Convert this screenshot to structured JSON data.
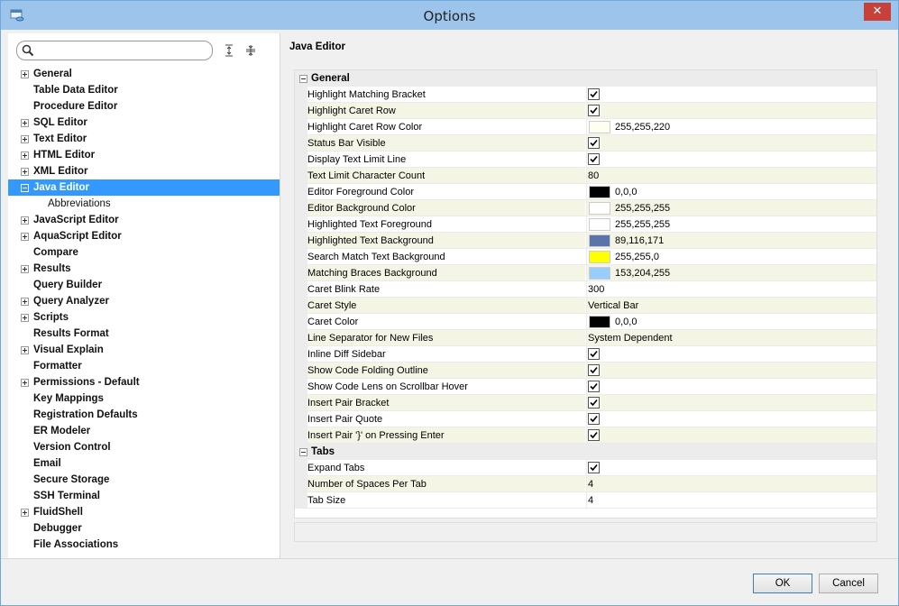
{
  "window": {
    "title": "Options",
    "close_glyph": "✕"
  },
  "search": {
    "placeholder": "",
    "value": ""
  },
  "tree": [
    {
      "label": "General",
      "expander": "plus"
    },
    {
      "label": "Table Data Editor",
      "expander": "none"
    },
    {
      "label": "Procedure Editor",
      "expander": "none"
    },
    {
      "label": "SQL Editor",
      "expander": "plus"
    },
    {
      "label": "Text Editor",
      "expander": "plus"
    },
    {
      "label": "HTML Editor",
      "expander": "plus"
    },
    {
      "label": "XML Editor",
      "expander": "plus"
    },
    {
      "label": "Java Editor",
      "expander": "minus",
      "selected": true
    },
    {
      "label": "Abbreviations",
      "expander": "none",
      "sub": true
    },
    {
      "label": "JavaScript Editor",
      "expander": "plus"
    },
    {
      "label": "AquaScript Editor",
      "expander": "plus"
    },
    {
      "label": "Compare",
      "expander": "none"
    },
    {
      "label": "Results",
      "expander": "plus"
    },
    {
      "label": "Query Builder",
      "expander": "none"
    },
    {
      "label": "Query Analyzer",
      "expander": "plus"
    },
    {
      "label": "Scripts",
      "expander": "plus"
    },
    {
      "label": "Results Format",
      "expander": "none"
    },
    {
      "label": "Visual Explain",
      "expander": "plus"
    },
    {
      "label": "Formatter",
      "expander": "none"
    },
    {
      "label": "Permissions - Default",
      "expander": "plus"
    },
    {
      "label": "Key Mappings",
      "expander": "none"
    },
    {
      "label": "Registration Defaults",
      "expander": "none"
    },
    {
      "label": "ER Modeler",
      "expander": "none"
    },
    {
      "label": "Version Control",
      "expander": "none"
    },
    {
      "label": "Email",
      "expander": "none"
    },
    {
      "label": "Secure Storage",
      "expander": "none"
    },
    {
      "label": "SSH Terminal",
      "expander": "none"
    },
    {
      "label": "FluidShell",
      "expander": "plus"
    },
    {
      "label": "Debugger",
      "expander": "none"
    },
    {
      "label": "File Associations",
      "expander": "none"
    }
  ],
  "panel": {
    "title": "Java Editor"
  },
  "grid": [
    {
      "type": "category",
      "label": "General"
    },
    {
      "label": "Highlight Matching Bracket",
      "kind": "check",
      "checked": true
    },
    {
      "label": "Highlight Caret Row",
      "kind": "check",
      "checked": true
    },
    {
      "label": "Highlight Caret Row Color",
      "kind": "color",
      "color": "#fffff0",
      "text": "255,255,220"
    },
    {
      "label": "Status Bar Visible",
      "kind": "check",
      "checked": true
    },
    {
      "label": "Display Text Limit Line",
      "kind": "check",
      "checked": true
    },
    {
      "label": "Text Limit Character Count",
      "kind": "text",
      "text": "80"
    },
    {
      "label": "Editor Foreground Color",
      "kind": "color",
      "color": "#000000",
      "text": "0,0,0"
    },
    {
      "label": "Editor Background Color",
      "kind": "color",
      "color": "#ffffff",
      "text": "255,255,255"
    },
    {
      "label": "Highlighted Text Foreground",
      "kind": "color",
      "color": "#ffffff",
      "text": "255,255,255"
    },
    {
      "label": "Highlighted Text Background",
      "kind": "color",
      "color": "#5974ab",
      "text": "89,116,171"
    },
    {
      "label": "Search Match Text Background",
      "kind": "color",
      "color": "#ffff00",
      "text": "255,255,0"
    },
    {
      "label": "Matching Braces Background",
      "kind": "color",
      "color": "#99ccff",
      "text": "153,204,255"
    },
    {
      "label": "Caret Blink Rate",
      "kind": "text",
      "text": "300"
    },
    {
      "label": "Caret Style",
      "kind": "text",
      "text": "Vertical Bar"
    },
    {
      "label": "Caret Color",
      "kind": "color",
      "color": "#000000",
      "text": "0,0,0"
    },
    {
      "label": "Line Separator for New Files",
      "kind": "text",
      "text": "System Dependent"
    },
    {
      "label": "Inline Diff Sidebar",
      "kind": "check",
      "checked": true
    },
    {
      "label": "Show Code Folding Outline",
      "kind": "check",
      "checked": true
    },
    {
      "label": "Show Code Lens on Scrollbar Hover",
      "kind": "check",
      "checked": true
    },
    {
      "label": "Insert Pair Bracket",
      "kind": "check",
      "checked": true
    },
    {
      "label": "Insert Pair Quote",
      "kind": "check",
      "checked": true
    },
    {
      "label": "Insert Pair '}' on Pressing Enter",
      "kind": "check",
      "checked": true
    },
    {
      "type": "category",
      "label": "Tabs"
    },
    {
      "label": "Expand Tabs",
      "kind": "check",
      "checked": true
    },
    {
      "label": "Number of Spaces Per Tab",
      "kind": "text",
      "text": "4"
    },
    {
      "label": "Tab Size",
      "kind": "text",
      "text": "4"
    }
  ],
  "buttons": {
    "ok": "OK",
    "cancel": "Cancel"
  }
}
